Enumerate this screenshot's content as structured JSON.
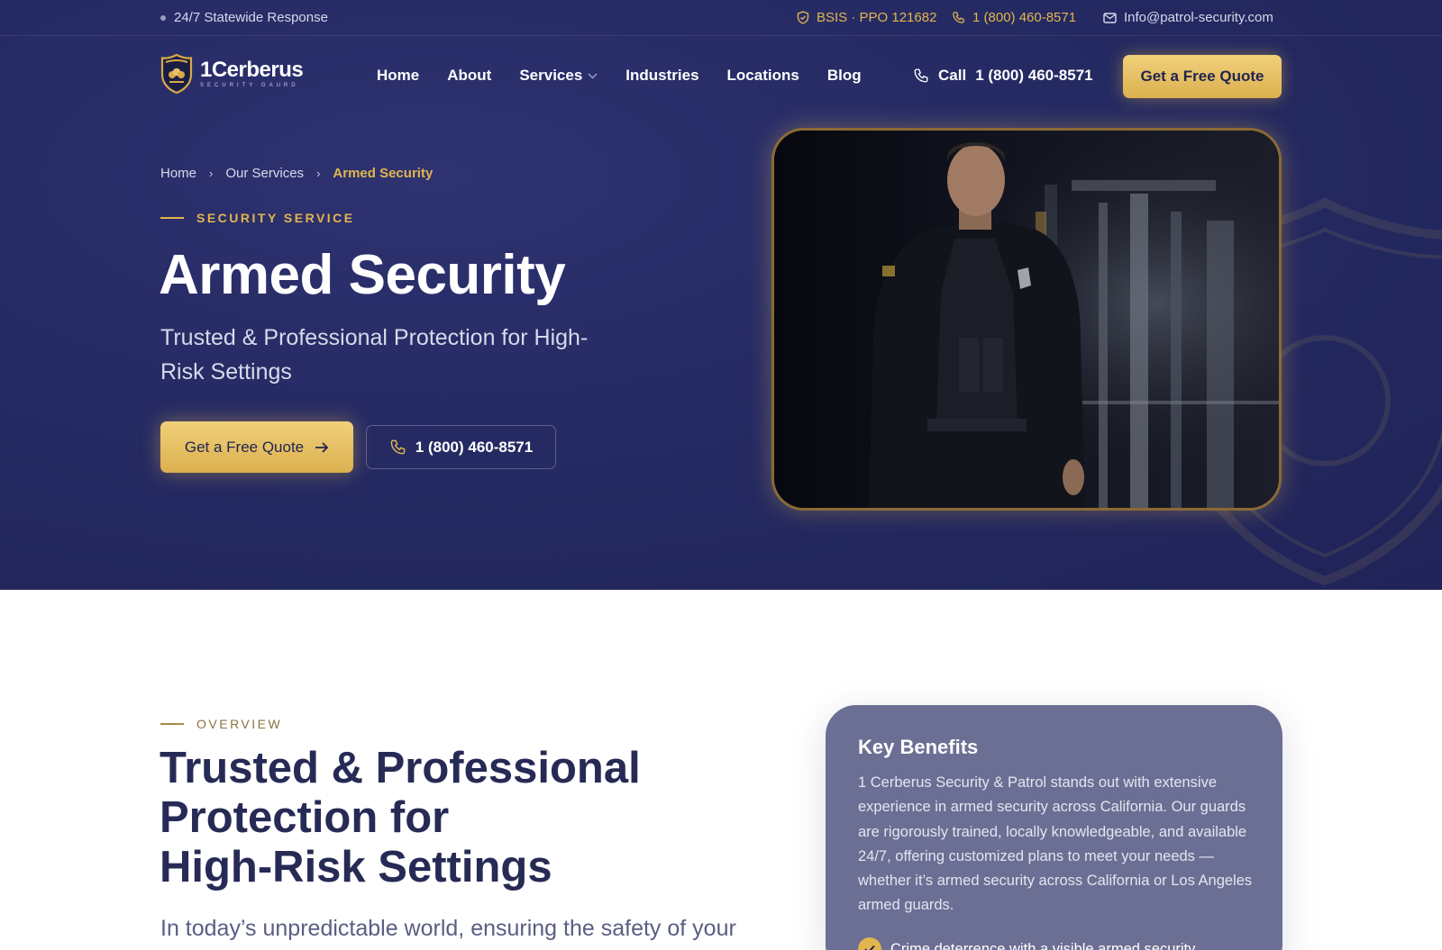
{
  "colors": {
    "navy": "#252a63",
    "gold": "#e2b64e",
    "card": "#6c6f94"
  },
  "topbar": {
    "response": "24/7 Statewide Response",
    "license": "BSIS · PPO 121682",
    "phone": "1 (800) 460-8571",
    "email": "Info@patrol-security.com"
  },
  "brand": {
    "name": "1Cerberus",
    "tagline": "SECURITY GAURD"
  },
  "nav": {
    "items": [
      {
        "label": "Home"
      },
      {
        "label": "About"
      },
      {
        "label": "Services"
      },
      {
        "label": "Industries"
      },
      {
        "label": "Locations"
      },
      {
        "label": "Blog"
      }
    ],
    "call_label": "Call",
    "call_phone": "1 (800) 460-8571",
    "quote_label": "Get a Free Quote"
  },
  "hero": {
    "breadcrumb": [
      "Home",
      "Our Services",
      "Armed Security"
    ],
    "eyebrow": "SECURITY SERVICE",
    "title": "Armed Security",
    "subtitle": "Trusted & Professional Protection for High-Risk Settings",
    "primary_cta": "Get a Free Quote",
    "phone_cta": "1 (800) 460-8571"
  },
  "overview": {
    "eyebrow": "OVERVIEW",
    "title_line1": "Trusted & Professional",
    "title_line2": "Protection for",
    "title_line3": "High-Risk Settings",
    "body": "In today’s unpredictable world, ensuring the safety of your"
  },
  "key_benefits": {
    "title": "Key Benefits",
    "text": "1 Cerberus Security & Patrol stands out with extensive experience in armed security across California. Our guards are rigorously trained, locally knowledgeable, and available 24/7, offering customized plans to meet your needs — whether it’s armed security across California or Los Angeles armed guards.",
    "first_bullet": "Crime deterrence with a visible armed security"
  }
}
